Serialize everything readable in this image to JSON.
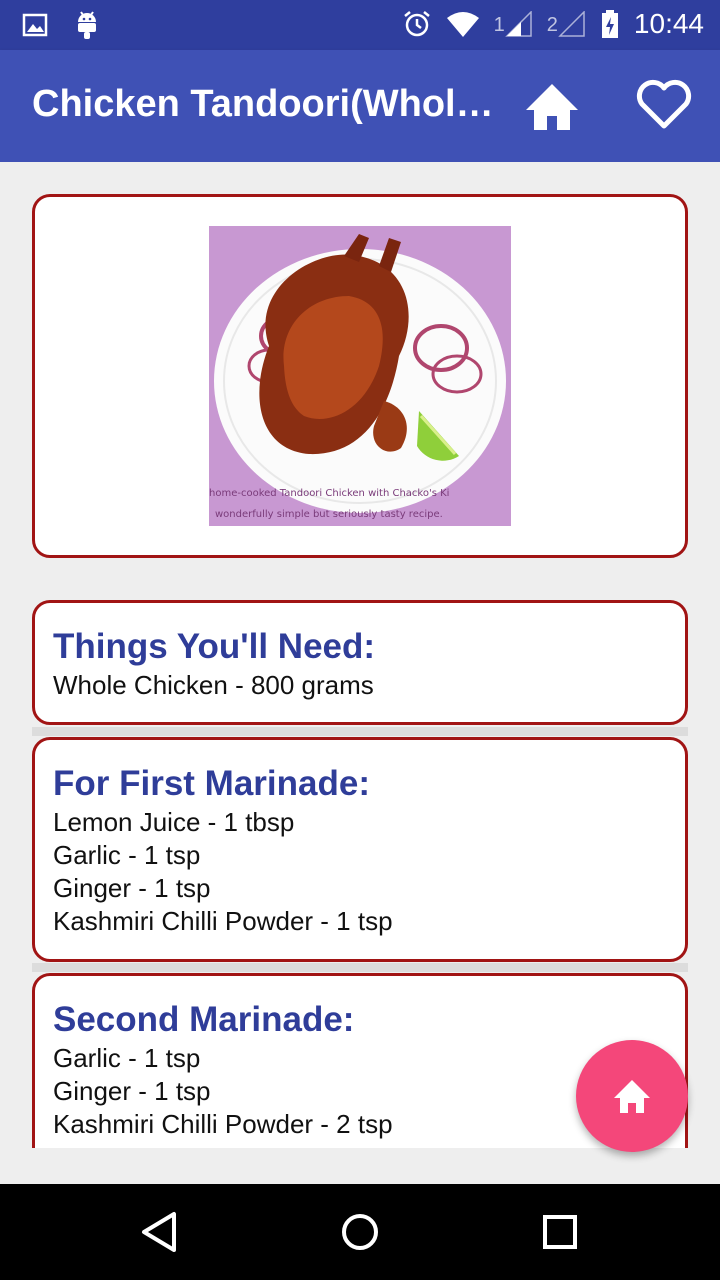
{
  "status_bar": {
    "time": "10:44",
    "sim1_label": "1",
    "sim2_label": "2",
    "icons": [
      "image-icon",
      "android-icon",
      "alarm-icon",
      "wifi-icon",
      "signal-icon",
      "battery-icon"
    ]
  },
  "app_bar": {
    "title": "Chicken Tandoori(Whol…",
    "actions": [
      "home-icon",
      "heart-icon"
    ],
    "color": "#3f51b5"
  },
  "recipe_image": {
    "caption_line1": "home-cooked Tandoori Chicken with Chacko's Ki",
    "caption_line2": "wonderfully simple but seriously tasty recipe."
  },
  "sections": [
    {
      "heading": "Things You'll Need:",
      "items": [
        "Whole Chicken - 800 grams"
      ]
    },
    {
      "heading": "For First Marinade:",
      "items": [
        "Lemon Juice - 1 tbsp",
        "Garlic - 1 tsp",
        "Ginger - 1 tsp",
        "Kashmiri Chilli Powder - 1 tsp"
      ]
    },
    {
      "heading": "Second Marinade:",
      "items": [
        "Garlic - 1 tsp",
        "Ginger - 1 tsp",
        "Kashmiri Chilli Powder - 2 tsp"
      ]
    }
  ],
  "colors": {
    "card_border": "#a11414",
    "heading": "#2f3d99",
    "fab": "#f4477a"
  },
  "fab": {
    "icon": "home-icon"
  },
  "nav_bar": {
    "buttons": [
      "back-icon",
      "home-circle-icon",
      "recents-icon"
    ]
  }
}
